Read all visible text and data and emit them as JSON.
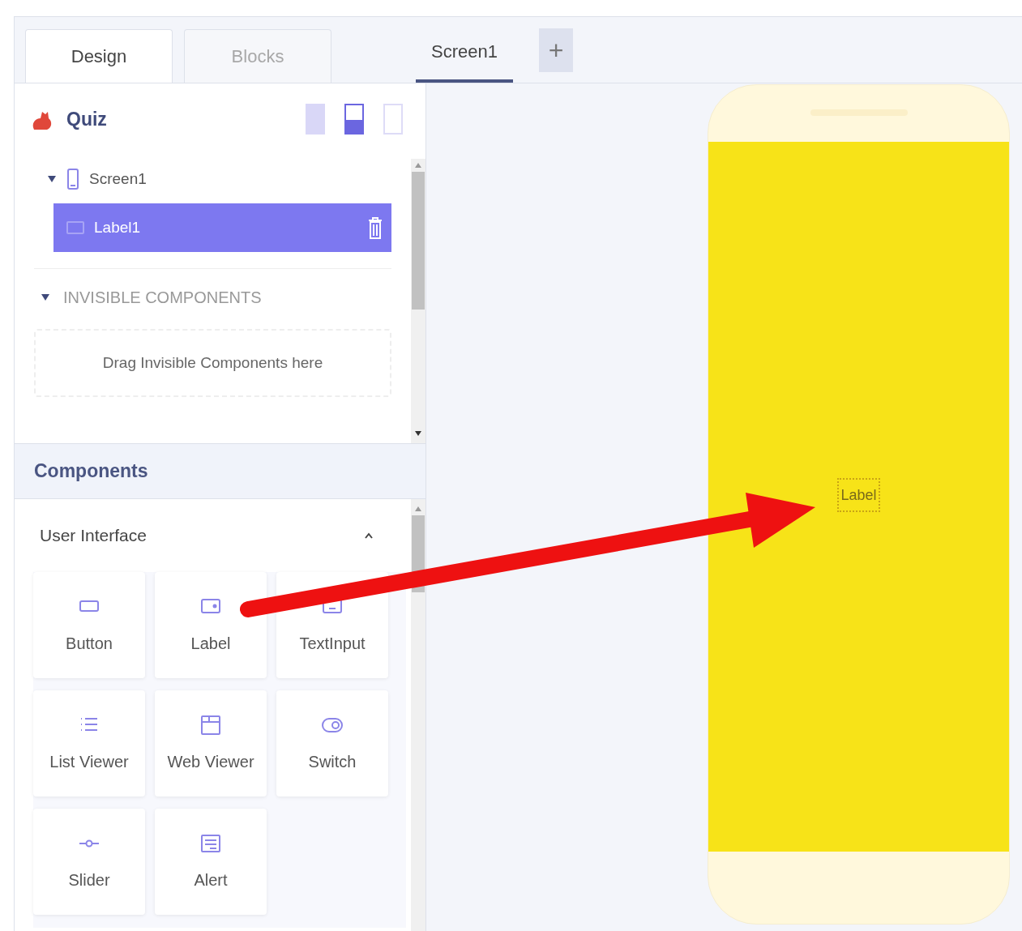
{
  "tabs": [
    {
      "label": "Design",
      "selected": true
    },
    {
      "label": "Blocks",
      "selected": false
    }
  ],
  "screen_tabs": [
    {
      "label": "Screen1",
      "selected": true
    }
  ],
  "add_screen_button": {
    "label": "+"
  },
  "project": {
    "name": "Quiz"
  },
  "device_sizes": [
    {
      "selected": false
    },
    {
      "selected": true
    },
    {
      "selected": false
    }
  ],
  "tree": [
    {
      "label": "Screen1",
      "kind": "screen",
      "expanded": true,
      "selected": false,
      "children": [
        {
          "label": "Label1",
          "kind": "label",
          "selected": true
        }
      ]
    }
  ],
  "invisible_components": {
    "title": "INVISIBLE COMPONENTS",
    "expanded": true,
    "dropzone": "Drag Invisible Components here"
  },
  "components": {
    "title": "Components",
    "group": "User Interface",
    "expanded": true,
    "items": [
      {
        "label": "Button",
        "kind": "button"
      },
      {
        "label": "Label",
        "kind": "label"
      },
      {
        "label": "TextInput",
        "kind": "textinput"
      },
      {
        "label": "List Viewer",
        "kind": "list"
      },
      {
        "label": "Web Viewer",
        "kind": "web"
      },
      {
        "label": "Switch",
        "kind": "switch"
      },
      {
        "label": "Slider",
        "kind": "slider"
      },
      {
        "label": "Alert",
        "kind": "alert"
      }
    ]
  },
  "phone": {
    "label": "Label"
  }
}
